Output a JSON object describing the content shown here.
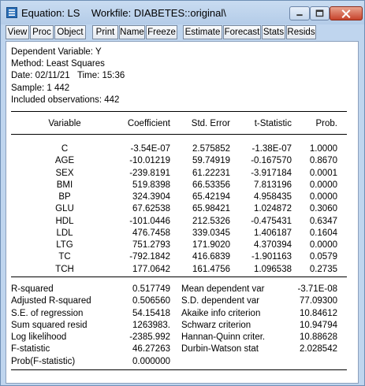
{
  "window": {
    "title": "Equation: LS    Workfile: DIABETES::original\\"
  },
  "toolbar": {
    "buttons": [
      "View",
      "Proc",
      "Object",
      "Print",
      "Name",
      "Freeze",
      "Estimate",
      "Forecast",
      "Stats",
      "Resids"
    ]
  },
  "header": {
    "lines": [
      "Dependent Variable: Y",
      "Method: Least Squares",
      "Date: 02/11/21   Time: 15:36",
      "Sample: 1 442",
      "Included observations: 442"
    ]
  },
  "table": {
    "columns": [
      "Variable",
      "Coefficient",
      "Std. Error",
      "t-Statistic",
      "Prob."
    ],
    "rows": [
      [
        "C",
        "-3.54E-07",
        "2.575852",
        "-1.38E-07",
        "1.0000"
      ],
      [
        "AGE",
        "-10.01219",
        "59.74919",
        "-0.167570",
        "0.8670"
      ],
      [
        "SEX",
        "-239.8191",
        "61.22231",
        "-3.917184",
        "0.0001"
      ],
      [
        "BMI",
        "519.8398",
        "66.53356",
        "7.813196",
        "0.0000"
      ],
      [
        "BP",
        "324.3904",
        "65.42194",
        "4.958435",
        "0.0000"
      ],
      [
        "GLU",
        "67.62538",
        "65.98421",
        "1.024872",
        "0.3060"
      ],
      [
        "HDL",
        "-101.0446",
        "212.5326",
        "-0.475431",
        "0.6347"
      ],
      [
        "LDL",
        "476.7458",
        "339.0345",
        "1.406187",
        "0.1604"
      ],
      [
        "LTG",
        "751.2793",
        "171.9020",
        "4.370394",
        "0.0000"
      ],
      [
        "TC",
        "-792.1842",
        "416.6839",
        "-1.901163",
        "0.0579"
      ],
      [
        "TCH",
        "177.0642",
        "161.4756",
        "1.096538",
        "0.2735"
      ]
    ]
  },
  "stats": {
    "rows": [
      [
        "R-squared",
        "0.517749",
        "Mean dependent var",
        "-3.71E-08"
      ],
      [
        "Adjusted R-squared",
        "0.506560",
        "S.D. dependent var",
        "77.09300"
      ],
      [
        "S.E. of regression",
        "54.15418",
        "Akaike info criterion",
        "10.84612"
      ],
      [
        "Sum squared resid",
        "1263983.",
        "Schwarz criterion",
        "10.94794"
      ],
      [
        "Log likelihood",
        "-2385.992",
        "Hannan-Quinn criter.",
        "10.88628"
      ],
      [
        "F-statistic",
        "46.27263",
        "Durbin-Watson stat",
        "2.028542"
      ],
      [
        "Prob(F-statistic)",
        "0.000000",
        "",
        ""
      ]
    ]
  },
  "colors": {
    "titlebar": "#c9dcf1",
    "close_button": "#c7432b",
    "background": "#ffffff"
  }
}
